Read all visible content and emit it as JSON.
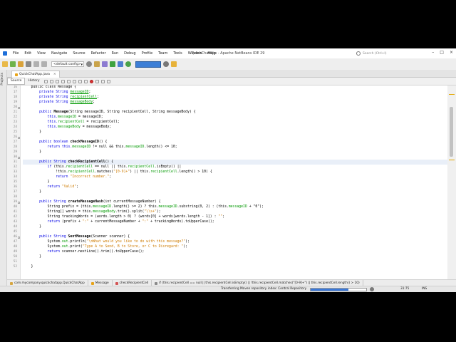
{
  "window": {
    "title": "QuickChatApp - Apache NetBeans IDE 29"
  },
  "menu": [
    "File",
    "Edit",
    "View",
    "Navigate",
    "Source",
    "Refactor",
    "Run",
    "Debug",
    "Profile",
    "Team",
    "Tools",
    "Window",
    "Help"
  ],
  "search": {
    "placeholder": "Search (Ctrl+I)"
  },
  "toolbar": {
    "config": "<default config>",
    "memory_label": ""
  },
  "left_strip": {
    "label": "Projects"
  },
  "editor_tab": {
    "label": "QuickChatApp.java"
  },
  "editor_views": {
    "source": "Source",
    "history": "History"
  },
  "gutter": {
    "lines": [
      "16",
      "17",
      "18",
      "19",
      "20",
      "21",
      "22",
      "23",
      "24",
      "25",
      "26",
      "27",
      "28",
      "29",
      "30",
      "31",
      "32",
      "33",
      "34",
      "35",
      "36",
      "37",
      "38",
      "39",
      "40",
      "41",
      "42",
      "43",
      "44",
      "45",
      "46",
      "47",
      "48",
      "49",
      "50",
      "51",
      "52"
    ]
  },
  "code": {
    "l16": "    public class Message {",
    "l17_a": "        private String ",
    "l17_f": "messageID",
    "l17_b": ";",
    "l18_a": "        private String ",
    "l18_f": "recipientCell",
    "l18_b": ";",
    "l19_a": "        private String ",
    "l19_f": "messageBody",
    "l19_b": ";",
    "l21_k": "        public ",
    "l21_m": "Message",
    "l21_b": "(String messageID, String recipientCell, String messageBody) {",
    "l22_a": "            this.",
    "l22_f": "messageID",
    "l22_b": " = messageID;",
    "l23_a": "            this.",
    "l23_f": "recipientCell",
    "l23_b": " = recipientCell;",
    "l24_a": "            this.",
    "l24_f": "messageBody",
    "l24_b": " = messageBody;",
    "l25": "        }",
    "l27_k": "        public boolean ",
    "l27_m": "checkMessageID",
    "l27_b": "() {",
    "l28_k": "            return ",
    "l28_a": "this.",
    "l28_f": "messageID",
    "l28_b": " != null && this.",
    "l28_f2": "messageID",
    "l28_c": ".length() <= 10;",
    "l29": "        }",
    "l31_k": "        public String ",
    "l31_m": "checkRecipientCell",
    "l31_b": "() {",
    "l32_k": "            if ",
    "l32_a": "(this.",
    "l32_f": "recipientCell",
    "l32_b": " == null || this.",
    "l32_f2": "recipientCell",
    "l32_c": ".isEmpty() ||",
    "l33_a": "                !this.",
    "l33_f": "recipientCell",
    "l33_b": ".matches(",
    "l33_s": "\"[0-9]+\"",
    "l33_c": ") || this.",
    "l33_f2": "recipientCell",
    "l33_d": ".length() > 10) {",
    "l34_k": "                return ",
    "l34_s": "\"Incorrect number.\"",
    "l34_b": ";",
    "l35": "            }",
    "l36_k": "            return ",
    "l36_s": "\"Valid\"",
    "l36_b": ";",
    "l37": "        }",
    "l39_k": "        public String ",
    "l39_m": "createMessageHash",
    "l39_b": "(int currentMessageNumber) {",
    "l40_a": "            String prefix = (this.",
    "l40_f": "messageID",
    "l40_b": ".length() >= 2) ? this.",
    "l40_f2": "messageID",
    "l40_c": ".substring(0, 2) : (this.",
    "l40_f3": "messageID",
    "l40_d": " + \"0\");",
    "l41_a": "            String[] words = this.",
    "l41_f": "messageBody",
    "l41_b": ".trim().split(",
    "l41_s": "\"\\\\s+\"",
    "l41_c": ");",
    "l42_a": "            String trackingWords = (words.length > 0) ? (words[0] + words[words.length - 1]) : ",
    "l42_s": "\"\"",
    "l42_b": ";",
    "l43_k": "            return ",
    "l43_a": "(prefix + ",
    "l43_s": "\":\"",
    "l43_b": " + currentMessageNumber + ",
    "l43_s2": "\":\"",
    "l43_c": " + trackingWords).toUpperCase();",
    "l44": "        }",
    "l46_k": "        public String ",
    "l46_m": "SentMessage",
    "l46_b": "(Scanner scanner) {",
    "l47_a": "            System.",
    "l47_f": "out",
    "l47_b": ".println(",
    "l47_s": "\"\\nWhat would you like to do with this message?\"",
    "l47_c": ");",
    "l48_a": "            System.",
    "l48_f": "out",
    "l48_b": ".print(",
    "l48_s": "\"Type A to Send, B to Store, or C to Disregard: \"",
    "l48_c": ");",
    "l49_k": "            return ",
    "l49_b": "scanner.nextLine().trim().toUpperCase();",
    "l50": "        }",
    "l52": "    }"
  },
  "breadcrumbs": {
    "package": "com.mycompany.quickchatapp.QuickChatApp",
    "class": "Message",
    "method": "checkRecipientCell",
    "expr": "if (this.recipientCell == null || this.recipientCell.isEmpty() || !this.recipientCell.matches(\"[0-9]+\") || this.recipientCell.length() > 10)"
  },
  "status": {
    "task": "Transferring Maven repository index: Central Repository",
    "progress": 0.68,
    "position": "31:75",
    "mode": "INS"
  },
  "colors": {
    "accent": "#1e6fd9",
    "keyword": "#0000e6",
    "field": "#009900",
    "string": "#ce7b00"
  }
}
